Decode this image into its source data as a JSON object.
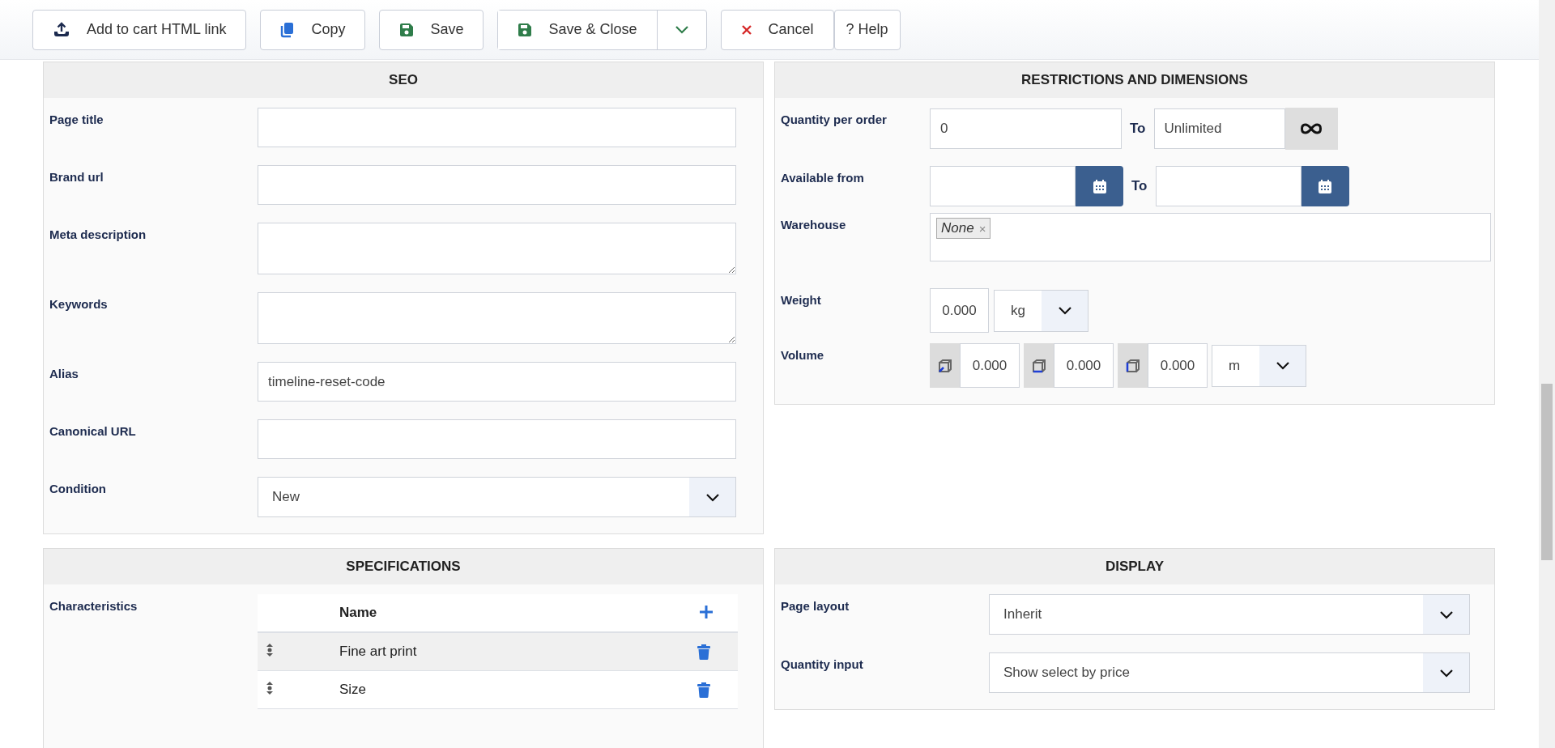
{
  "toolbar": {
    "buttons": [
      {
        "kind": "upload",
        "label": "Add to cart HTML link"
      },
      {
        "kind": "copy",
        "label": "Copy"
      },
      {
        "kind": "save",
        "label": "Save"
      },
      {
        "kind": "split-save",
        "label": "Save & Close"
      },
      {
        "kind": "cancel",
        "label": "Cancel"
      },
      {
        "kind": "help",
        "label": "? Help"
      }
    ]
  },
  "seo": {
    "title": "SEO",
    "fields": [
      {
        "kind": "input",
        "label": "Page title"
      },
      {
        "kind": "input",
        "label": "Brand url"
      },
      {
        "kind": "textarea",
        "label": "Meta description"
      },
      {
        "kind": "textarea",
        "label": "Keywords"
      },
      {
        "kind": "input",
        "label": "Alias",
        "value": "timeline-reset-code"
      },
      {
        "kind": "input",
        "label": "Canonical URL"
      },
      {
        "kind": "select",
        "label": "Condition",
        "value": "New"
      }
    ]
  },
  "restrictions": {
    "title": "RESTRICTIONS AND DIMENSIONS",
    "quantity": {
      "label": "Quantity per order",
      "from": "0",
      "to_label": "To",
      "to": "Unlimited"
    },
    "available": {
      "label": "Available from",
      "to_label": "To"
    },
    "warehouse": {
      "label": "Warehouse",
      "tags": [
        {
          "label": "None",
          "remove": "×"
        }
      ]
    },
    "weight": {
      "label": "Weight",
      "value": "0.000",
      "unit": "kg"
    },
    "volume": {
      "label": "Volume",
      "values": [
        "0.000",
        "0.000",
        "0.000"
      ],
      "unit": "m"
    }
  },
  "specifications": {
    "title": "SPECIFICATIONS",
    "label": "Characteristics",
    "column": "Name",
    "rows": [
      {
        "name": "Fine art print",
        "hovered": true
      },
      {
        "name": "Size",
        "hovered": false
      }
    ]
  },
  "display": {
    "title": "DISPLAY",
    "fields": [
      {
        "label": "Page layout",
        "value": "Inherit"
      },
      {
        "label": "Quantity input",
        "value": "Show select by price"
      }
    ]
  }
}
